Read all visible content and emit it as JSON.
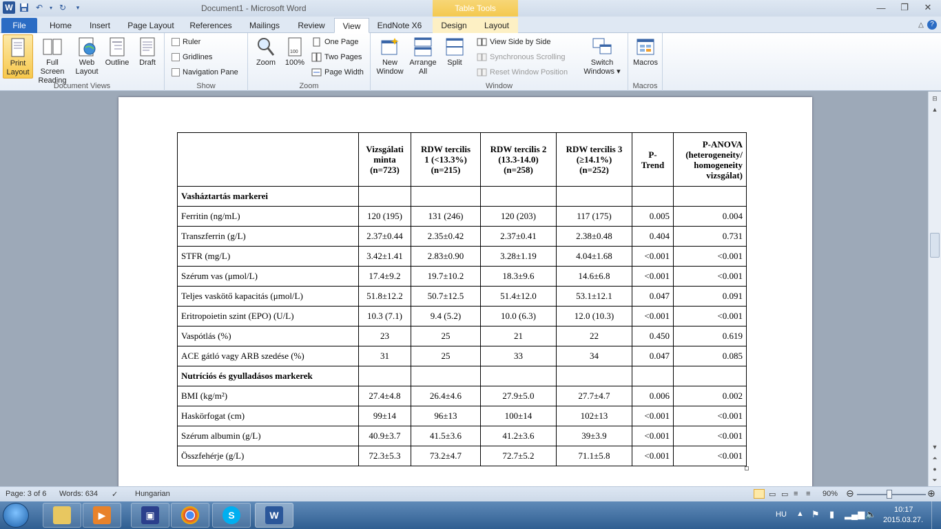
{
  "window": {
    "title": "Document1  -  Microsoft Word",
    "contextual_tab_group": "Table Tools"
  },
  "tabs": [
    "File",
    "Home",
    "Insert",
    "Page Layout",
    "References",
    "Mailings",
    "Review",
    "View",
    "EndNote X6",
    "Design",
    "Layout"
  ],
  "ribbon": {
    "document_views": {
      "label": "Document Views",
      "print_layout": [
        "Print",
        "Layout"
      ],
      "full_screen_reading": [
        "Full Screen",
        "Reading"
      ],
      "web_layout": [
        "Web",
        "Layout"
      ],
      "outline": "Outline",
      "draft": "Draft"
    },
    "show": {
      "label": "Show",
      "ruler": "Ruler",
      "gridlines": "Gridlines",
      "navigation_pane": "Navigation Pane"
    },
    "zoom": {
      "label": "Zoom",
      "zoom": "Zoom",
      "hundred": "100%",
      "one_page": "One Page",
      "two_pages": "Two Pages",
      "page_width": "Page Width"
    },
    "window": {
      "label": "Window",
      "new_window": [
        "New",
        "Window"
      ],
      "arrange_all": [
        "Arrange",
        "All"
      ],
      "split": "Split",
      "view_side_by_side": "View Side by Side",
      "synchronous_scrolling": "Synchronous Scrolling",
      "reset_window_position": "Reset Window Position",
      "switch_windows": [
        "Switch",
        "Windows ▾"
      ]
    },
    "macros": {
      "label": "Macros",
      "macros": "Macros"
    }
  },
  "table": {
    "headers": [
      "",
      [
        "Vizsgálati",
        "minta",
        "(n=723)"
      ],
      [
        "RDW tercilis",
        "1 (<13.3%)",
        "(n=215)"
      ],
      [
        "RDW tercilis 2",
        "(13.3-14.0)",
        "(n=258)"
      ],
      [
        "RDW tercilis 3",
        "(≥14.1%)",
        "(n=252)"
      ],
      [
        "P-",
        "Trend"
      ],
      [
        "P-ANOVA",
        "(heterogeneity/",
        "homogeneity",
        "vizsgálat)"
      ]
    ],
    "rows": [
      {
        "section": "Vasháztartás  markerei"
      },
      {
        "cells": [
          "Ferritin (ng/mL)",
          "120 (195)",
          "131 (246)",
          "120 (203)",
          "117 (175)",
          "0.005",
          "0.004"
        ]
      },
      {
        "cells": [
          "Transzferrin  (g/L)",
          "2.37±0.44",
          "2.35±0.42",
          "2.37±0.41",
          "2.38±0.48",
          "0.404",
          "0.731"
        ]
      },
      {
        "cells": [
          "STFR (mg/L)",
          "3.42±1.41",
          "2.83±0.90",
          "3.28±1.19",
          "4.04±1.68",
          "<0.001",
          "<0.001"
        ]
      },
      {
        "cells": [
          "Szérum vas (μmol/L)",
          "17.4±9.2",
          "19.7±10.2",
          "18.3±9.6",
          "14.6±6.8",
          "<0.001",
          "<0.001"
        ]
      },
      {
        "cells": [
          "Teljes  vaskötő kapacitás  (μmol/L)",
          "51.8±12.2",
          "50.7±12.5",
          "51.4±12.0",
          "53.1±12.1",
          "0.047",
          "0.091"
        ]
      },
      {
        "cells": [
          "Eritropoietin szint  (EPO) (U/L)",
          "10.3 (7.1)",
          "9.4 (5.2)",
          "10.0 (6.3)",
          "12.0 (10.3)",
          "<0.001",
          "<0.001"
        ]
      },
      {
        "cells": [
          "Vaspótlás  (%)",
          "23",
          "25",
          "21",
          "22",
          "0.450",
          "0.619"
        ]
      },
      {
        "cells": [
          "ACE gátló vagy ARB szedése  (%)",
          "31",
          "25",
          "33",
          "34",
          "0.047",
          "0.085"
        ]
      },
      {
        "section": "Nutríciós  és gyulladásos markerek"
      },
      {
        "cells": [
          "BMI (kg/m²)",
          "27.4±4.8",
          "26.4±4.6",
          "27.9±5.0",
          "27.7±4.7",
          "0.006",
          "0.002"
        ]
      },
      {
        "cells": [
          "Haskörfogat  (cm)",
          "99±14",
          "96±13",
          "100±14",
          "102±13",
          "<0.001",
          "<0.001"
        ]
      },
      {
        "cells": [
          "Szérum albumin  (g/L)",
          "40.9±3.7",
          "41.5±3.6",
          "41.2±3.6",
          "39±3.9",
          "<0.001",
          "<0.001"
        ]
      },
      {
        "cells": [
          "Összfehérje  (g/L)",
          "72.3±5.3",
          "73.2±4.7",
          "72.7±5.2",
          "71.1±5.8",
          "<0.001",
          "<0.001"
        ]
      }
    ]
  },
  "statusbar": {
    "page": "Page: 3 of 6",
    "words": "Words: 634",
    "language": "Hungarian",
    "zoom": "90%"
  },
  "taskbar": {
    "lang": "HU",
    "time": "10:17",
    "date": "2015.03.27."
  }
}
